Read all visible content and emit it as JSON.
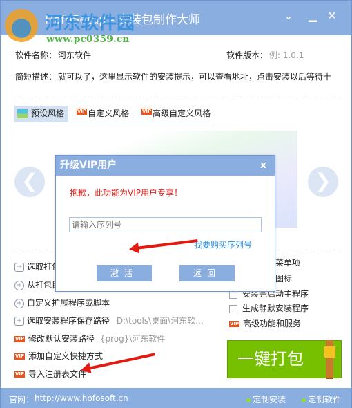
{
  "window": {
    "title": "HofoSetup - 安装包制作大师",
    "watermark": "河东软件园",
    "watermark_url": "www.pc0359.cn"
  },
  "titlebar_buttons": {
    "dropdown": "⌄",
    "minimize": "▁",
    "close": "✕"
  },
  "info": {
    "name_label": "软件名称：",
    "name_value": "河东软件",
    "version_label": "软件版本：",
    "version_placeholder": "例: 1.0.1",
    "desc_label": "简短描述：",
    "desc_value": "就可以了，这里显示软件的安装提示，可以查看地址，点击安装以后等待十"
  },
  "tabs": [
    {
      "label": "预设风格",
      "vip": false
    },
    {
      "label": "自定义风格",
      "vip": true
    },
    {
      "label": "高级自定义风格",
      "vip": true
    }
  ],
  "vip_badge": "VIP",
  "nav": {
    "prev": "❮",
    "next": "❯"
  },
  "left_items": [
    {
      "label": "选取打包文件夹",
      "icon": "folder-arrow-icon"
    },
    {
      "label": "从打包目录添加",
      "icon": "plus-circle-icon"
    },
    {
      "label": "自定义扩展程序或脚本",
      "icon": "plus-circle-icon"
    },
    {
      "label": "选取安装程序保存路径",
      "value": "D:\\tools\\桌面\\河东软...",
      "icon": "folder-plus-icon"
    },
    {
      "label": "修改默认安装路径",
      "value": "{prog}\\河东软件",
      "icon": "vip"
    },
    {
      "label": "添加自定义快捷方式",
      "icon": "vip"
    },
    {
      "label": "导入注册表文件",
      "icon": "vip"
    }
  ],
  "right_items": [
    {
      "label": "菜单项"
    },
    {
      "label": "图标"
    },
    {
      "label": "安装完启动主程序",
      "checked": false
    },
    {
      "label": "生成静默安装程序",
      "checked": false
    },
    {
      "label": "高级功能和服务",
      "vip": true
    }
  ],
  "build_button": "一键打包",
  "footer": {
    "site_label": "官网：",
    "site_url": "http://www.hofosoft.cn",
    "link1": "定制安装",
    "link2": "定制软件"
  },
  "dialog": {
    "title": "升级VIP用户",
    "close": "x",
    "message": "抱歉，此功能为VIP用户专享！",
    "serial_placeholder": "请输入序列号",
    "buy_link": "我要购买序列号",
    "activate": "激活",
    "back": "返回"
  },
  "colors": {
    "accent": "#8aaee0",
    "build": "#76c000",
    "vip": "#e8541c",
    "error": "#e0231a",
    "link": "#2c8fd8"
  }
}
